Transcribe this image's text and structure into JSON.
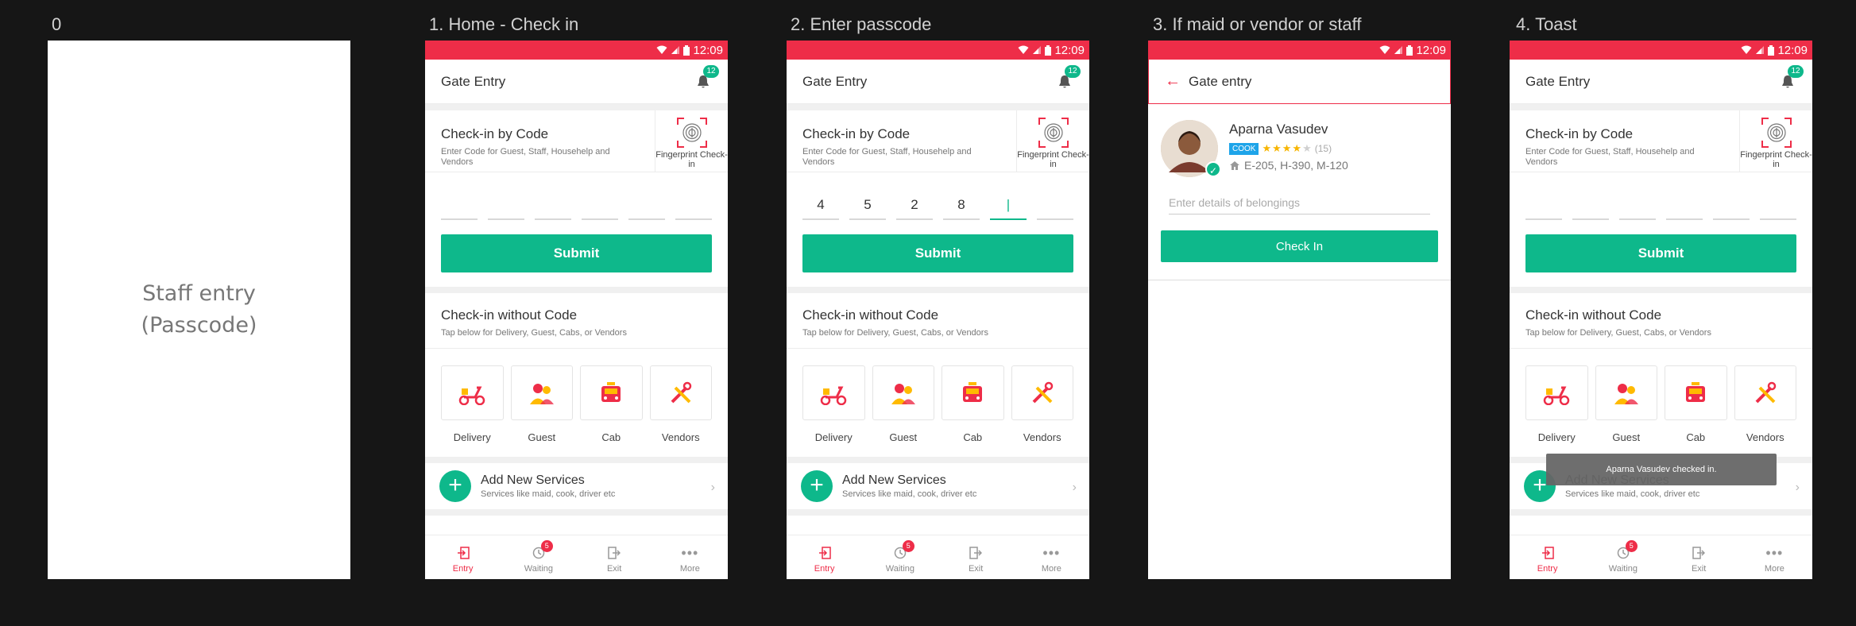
{
  "frames": [
    {
      "label": "0",
      "text_line1": "Staff entry",
      "text_line2": "(Passcode)"
    },
    {
      "label": "1. Home - Check in"
    },
    {
      "label": "2. Enter passcode"
    },
    {
      "label": "3. If maid or vendor or staff"
    },
    {
      "label": "4. Toast"
    }
  ],
  "status": {
    "time": "12:09"
  },
  "colors": {
    "accent": "#ee2d48",
    "primary": "#0eb88b",
    "chip": "#1ea4e9"
  },
  "home": {
    "title": "Gate Entry",
    "bell_count": "12",
    "check_by_code_title": "Check-in by Code",
    "check_by_code_sub": "Enter Code for Guest, Staff, Househelp and Vendors",
    "fingerprint_label": "Fingerprint Check-in",
    "submit_label": "Submit",
    "without_code_title": "Check-in without Code",
    "without_code_sub": "Tap below for Delivery, Guest, Cabs, or Vendors",
    "services": [
      "Delivery",
      "Guest",
      "Cab",
      "Vendors"
    ],
    "add_title": "Add New Services",
    "add_sub": "Services like maid, cook, driver etc",
    "nav": {
      "entry": "Entry",
      "waiting": "Waiting",
      "waiting_badge": "5",
      "exit": "Exit",
      "more": "More"
    }
  },
  "passcode": {
    "digits": [
      "4",
      "5",
      "2",
      "8",
      "|",
      ""
    ]
  },
  "detail": {
    "title": "Gate entry",
    "name": "Aparna Vasudev",
    "role": "COOK",
    "rating": "(15)",
    "address": "E-205, H-390, M-120",
    "belongings_placeholder": "Enter details of belongings",
    "checkin_label": "Check In"
  },
  "toast": {
    "message": "Aparna Vasudev checked in."
  }
}
